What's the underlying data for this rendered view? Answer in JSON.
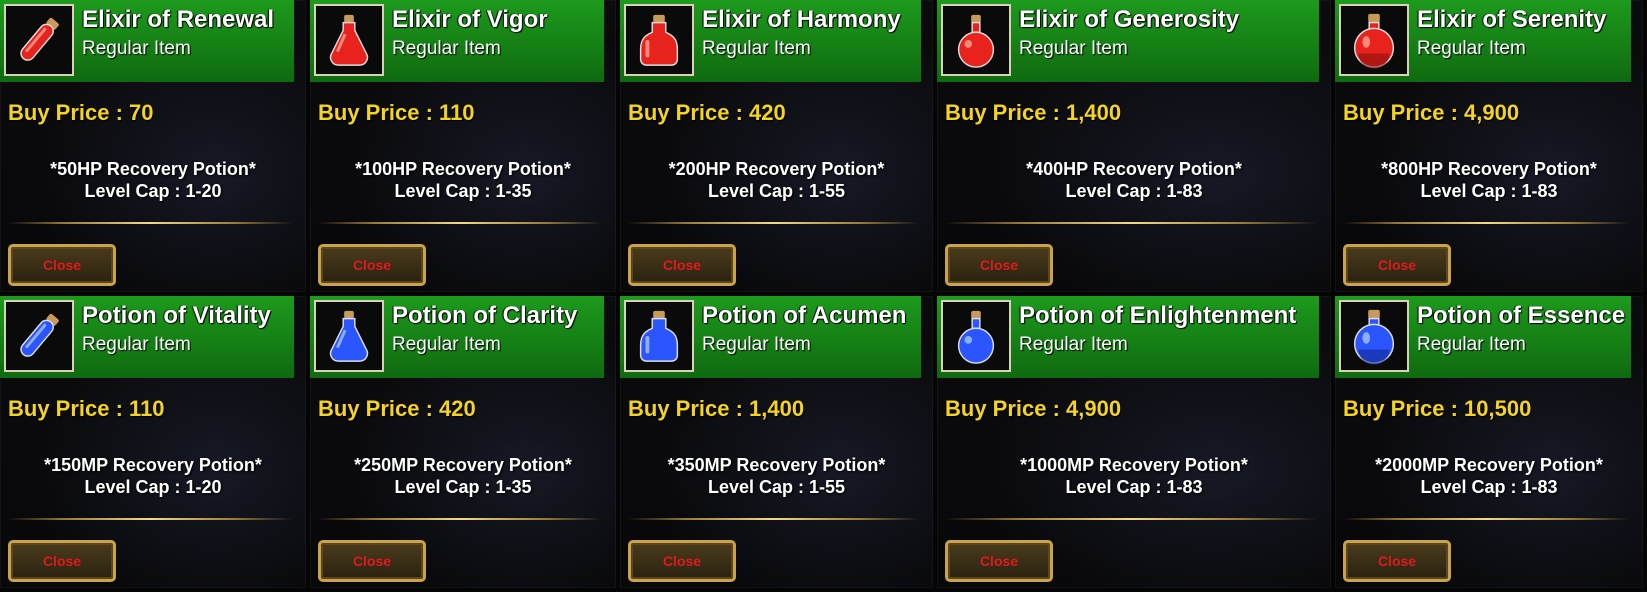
{
  "common": {
    "item_type": "Regular Item",
    "close_label": "Close"
  },
  "colors": {
    "header_green": "#178c17",
    "price_yellow": "#f4d321",
    "close_red": "#e0191c",
    "gold_border": "#c9a24a"
  },
  "items": [
    {
      "name": "Elixir of Renewal",
      "price": "Buy Price : 70",
      "line1": "*50HP Recovery Potion*",
      "line2": "Level Cap : 1-20",
      "icon": "red-potion-vial-icon"
    },
    {
      "name": "Elixir of Vigor",
      "price": "Buy Price : 110",
      "line1": "*100HP Recovery Potion*",
      "line2": "Level Cap : 1-35",
      "icon": "red-potion-flask-icon"
    },
    {
      "name": "Elixir of Harmony",
      "price": "Buy Price : 420",
      "line1": "*200HP Recovery Potion*",
      "line2": "Level Cap : 1-55",
      "icon": "red-potion-bottle-icon"
    },
    {
      "name": "Elixir of Generosity",
      "price": "Buy Price : 1,400",
      "line1": "*400HP Recovery Potion*",
      "line2": "Level Cap : 1-83",
      "icon": "red-potion-round-icon"
    },
    {
      "name": "Elixir of Serenity",
      "price": "Buy Price : 4,900",
      "line1": "*800HP Recovery Potion*",
      "line2": "Level Cap : 1-83",
      "icon": "red-potion-large-icon"
    },
    {
      "name": "Potion of Vitality",
      "price": "Buy Price : 110",
      "line1": "*150MP Recovery Potion*",
      "line2": "Level Cap : 1-20",
      "icon": "blue-potion-vial-icon"
    },
    {
      "name": "Potion of Clarity",
      "price": "Buy Price : 420",
      "line1": "*250MP Recovery Potion*",
      "line2": "Level Cap  : 1-35",
      "icon": "blue-potion-flask-icon"
    },
    {
      "name": "Potion of Acumen",
      "price": "Buy Price : 1,400",
      "line1": "*350MP Recovery Potion*",
      "line2": "Level Cap : 1-55",
      "icon": "blue-potion-bottle-icon"
    },
    {
      "name": "Potion of Enlightenment",
      "price": "Buy Price : 4,900",
      "line1": "*1000MP Recovery Potion*",
      "line2": "Level Cap : 1-83",
      "icon": "blue-potion-round-icon"
    },
    {
      "name": "Potion of Essence",
      "price": "Buy Price : 10,500",
      "line1": "*2000MP Recovery Potion*",
      "line2": "Level Cap : 1-83",
      "icon": "blue-potion-large-icon"
    }
  ]
}
